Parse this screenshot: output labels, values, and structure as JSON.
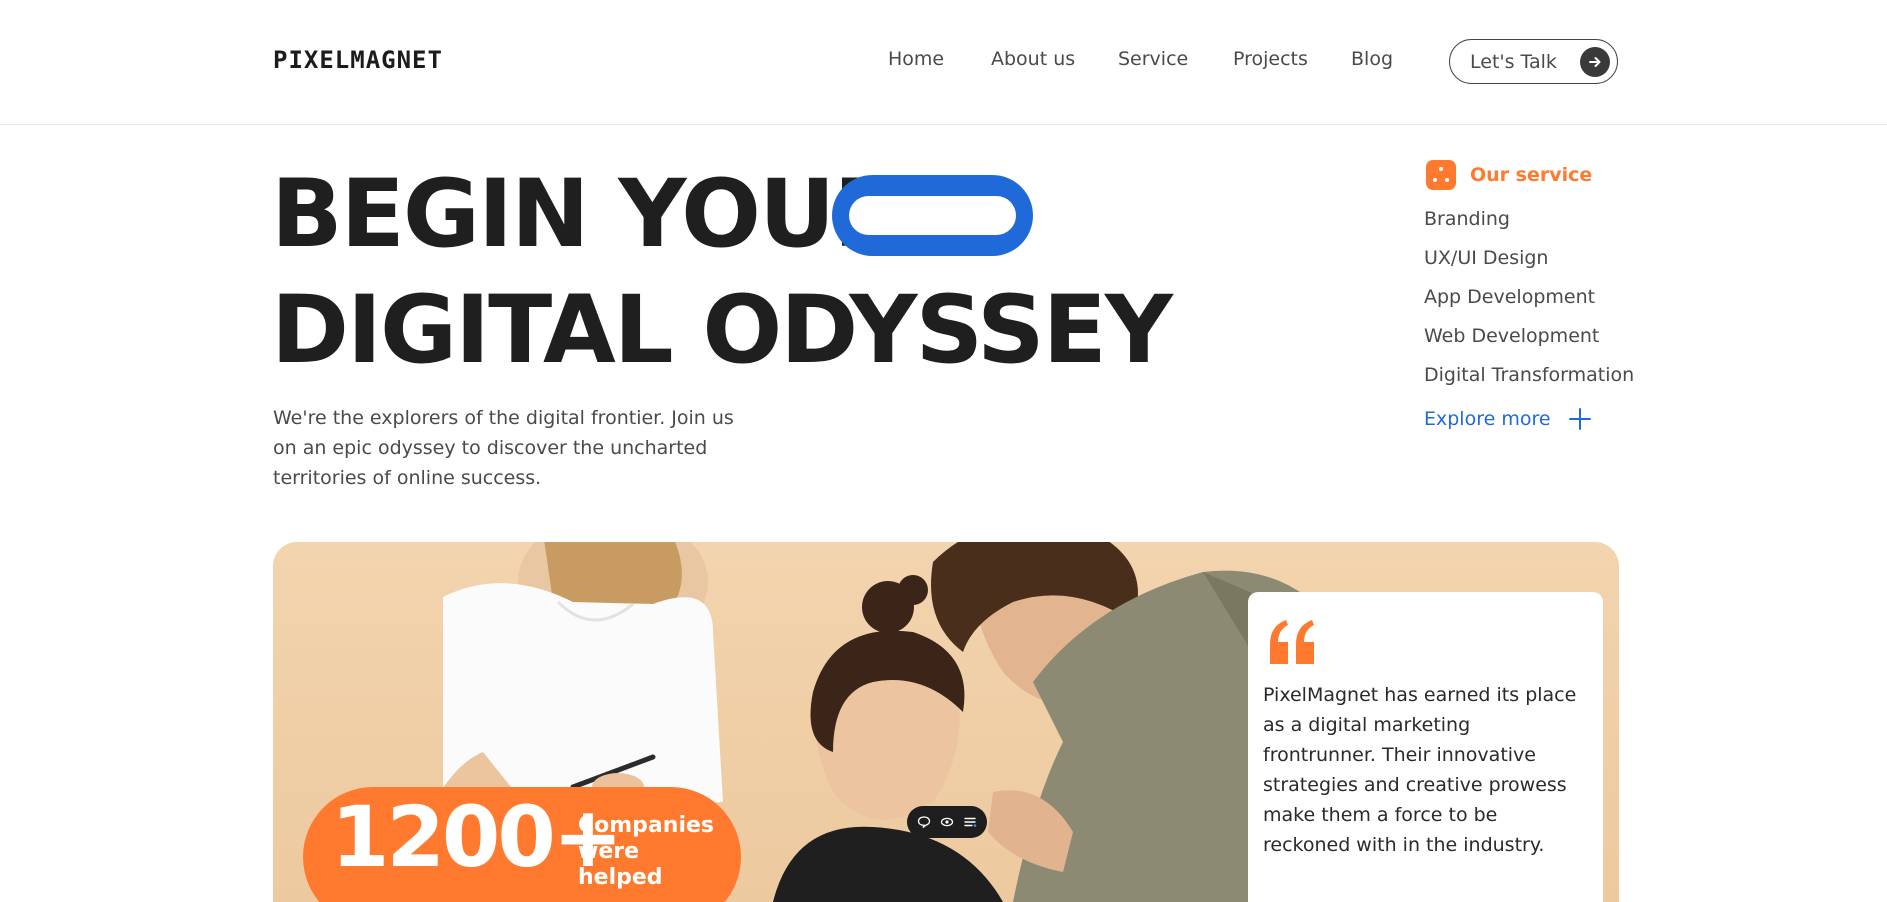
{
  "header": {
    "logo": "PIXELMAGNET",
    "nav": [
      "Home",
      "About us",
      "Service",
      "Projects",
      "Blog"
    ],
    "cta_label": "Let's Talk",
    "cta_icon": "arrow-right-icon"
  },
  "hero": {
    "title_line1": "BEGIN YOUR",
    "title_line2": "DIGITAL ODYSSEY",
    "description": "We're the explorers of the digital frontier. Join us on an epic odyssey to discover the uncharted territories of online success."
  },
  "services": {
    "title": "Our service",
    "items": [
      "Branding",
      "UX/UI Design",
      "App Development",
      "Web Development",
      "Digital Transformation"
    ],
    "explore_label": "Explore more",
    "explore_icon": "plus-icon"
  },
  "banner": {
    "stat_number": "1200+",
    "stat_label": "Companies were helped",
    "toolbar_icons": [
      "comment-icon",
      "eye-icon",
      "list-icon"
    ],
    "quote": "PixelMagnet has earned its place as a digital marketing frontrunner. Their innovative strategies and creative prowess make them a force to be reckoned with in the industry."
  },
  "colors": {
    "accent_orange": "#ff7a2e",
    "accent_blue": "#1f6ad8",
    "text_dark": "#1f1f1f",
    "text_body": "#4a4a4a",
    "banner_bg": "#f2d4ae"
  }
}
